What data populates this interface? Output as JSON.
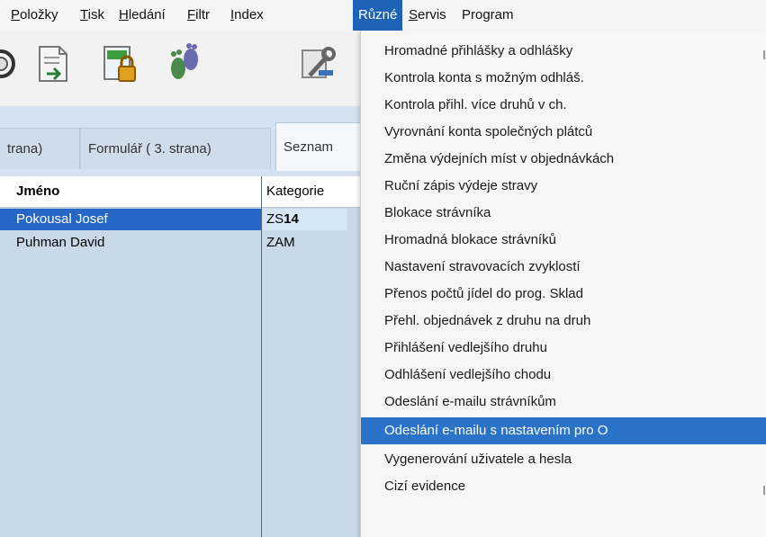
{
  "menubar": {
    "items": [
      {
        "label": "Položky"
      },
      {
        "label": "Tisk"
      },
      {
        "label": "Hledání"
      },
      {
        "label": "Filtr"
      },
      {
        "label": "Index"
      },
      {
        "label": "Různé",
        "open": true
      },
      {
        "label": "Servis"
      },
      {
        "label": "Program"
      }
    ]
  },
  "toolbar": {
    "icons": [
      "ring-icon",
      "document-arrow-icon",
      "lock-document-icon",
      "footprints-icon",
      "tools-icon"
    ]
  },
  "tabs": [
    {
      "label": "trana)"
    },
    {
      "label": "Formulář ( 3. strana)"
    },
    {
      "label": "Seznam",
      "active": true
    }
  ],
  "table": {
    "columns": [
      "Jméno",
      "Kategorie"
    ],
    "rows": [
      {
        "name": "Pokousal Josef",
        "category_prefix": "ZS",
        "category_bold": "14",
        "selected": true
      },
      {
        "name": "Puhman David",
        "category_prefix": "ZAM",
        "category_bold": "",
        "selected": false
      }
    ]
  },
  "dropdown": {
    "items": [
      {
        "label": "Hromadné přihlášky a odhlášky"
      },
      {
        "label": "Kontrola konta s možným odhláš."
      },
      {
        "label": "Kontrola přihl. více druhů v ch."
      },
      {
        "label": "Vyrovnání konta společných plátců"
      },
      {
        "label": "Změna výdejních míst v objednávkách"
      },
      {
        "label": "Ruční zápis výdeje stravy"
      },
      {
        "label": "Blokace strávníka"
      },
      {
        "label": "Hromadná blokace strávníků"
      },
      {
        "label": "Nastavení stravovacích zvyklostí"
      },
      {
        "label": "Přenos počtů jídel do prog. Sklad"
      },
      {
        "label": "Přehl. objednávek z druhu na druh"
      },
      {
        "label": "Přihlášení vedlejšího druhu"
      },
      {
        "label": "Odhlášení vedlejšího chodu"
      },
      {
        "label": "Odeslání e-mailu strávníkům"
      },
      {
        "label": "Odeslání e-mailu s nastavením pro O",
        "highlighted": true
      },
      {
        "label": "Vygenerování uživatele a hesla"
      },
      {
        "label": "Cizí evidence"
      }
    ]
  },
  "colors": {
    "menu_open": "#1e63b8",
    "highlight": "#2a73c9",
    "selected_row": "#2567c4",
    "grid_bg": "#c9d9e8"
  }
}
